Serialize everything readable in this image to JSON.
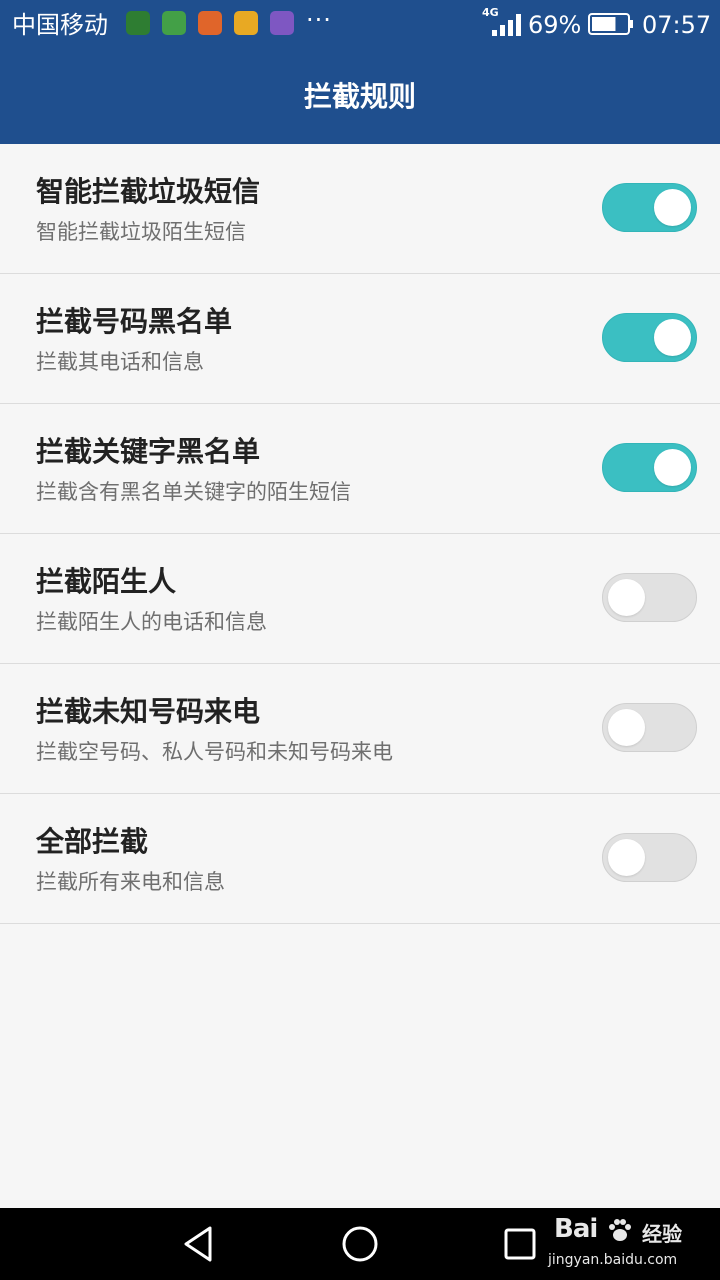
{
  "status_bar": {
    "carrier": "中国移动",
    "notification_icons": [
      {
        "name": "app-icon-green",
        "color": "#2e7d32"
      },
      {
        "name": "app-icon-multicolor",
        "color": "#43a047"
      },
      {
        "name": "app-icon-orange",
        "color": "#e0652a"
      },
      {
        "name": "app-icon-yellow-lock",
        "color": "#e8a923"
      },
      {
        "name": "app-icon-purple-gallery",
        "color": "#7e57c2"
      }
    ],
    "more": "···",
    "network_type": "4G",
    "battery_percent": "69%",
    "battery_level": 0.69,
    "time": "07:57"
  },
  "title_bar": {
    "title": "拦截规则"
  },
  "rules": [
    {
      "title": "智能拦截垃圾短信",
      "subtitle": "智能拦截垃圾陌生短信",
      "enabled": true
    },
    {
      "title": "拦截号码黑名单",
      "subtitle": "拦截其电话和信息",
      "enabled": true
    },
    {
      "title": "拦截关键字黑名单",
      "subtitle": "拦截含有黑名单关键字的陌生短信",
      "enabled": true
    },
    {
      "title": "拦截陌生人",
      "subtitle": "拦截陌生人的电话和信息",
      "enabled": false
    },
    {
      "title": "拦截未知号码来电",
      "subtitle": "拦截空号码、私人号码和未知号码来电",
      "enabled": false
    },
    {
      "title": "全部拦截",
      "subtitle": "拦截所有来电和信息",
      "enabled": false
    }
  ],
  "colors": {
    "header": "#1f4f8e",
    "toggle_on": "#3bbfc2",
    "toggle_off": "#e1e1e1",
    "background": "#f6f6f6"
  },
  "watermark": {
    "brand": "Bai",
    "brand_suffix": "经验",
    "url": "jingyan.baidu.com"
  }
}
